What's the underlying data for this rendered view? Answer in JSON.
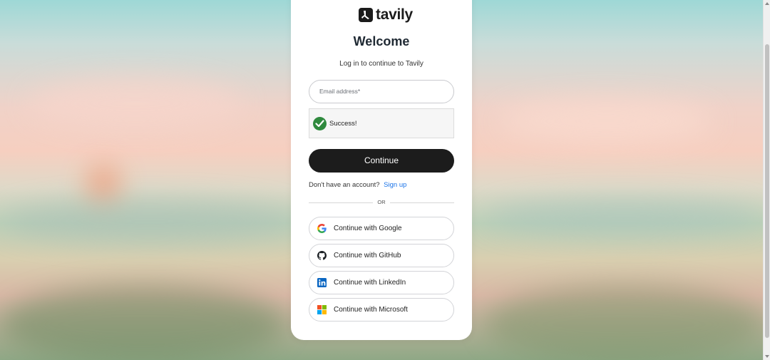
{
  "brand": {
    "name": "tavily",
    "icon": "tavily-logo-icon"
  },
  "heading": {
    "title": "Welcome",
    "subtitle": "Log in to continue to Tavily"
  },
  "email": {
    "placeholder": "Email address*"
  },
  "captcha": {
    "status": "Success!",
    "icon": "checkmark-icon",
    "color": "#2f8a3e"
  },
  "continue": {
    "label": "Continue"
  },
  "signup": {
    "prompt": "Don't have an account?",
    "link": "Sign up"
  },
  "divider": {
    "label": "OR"
  },
  "social": [
    {
      "label": "Continue with Google",
      "icon": "google-icon"
    },
    {
      "label": "Continue with GitHub",
      "icon": "github-icon"
    },
    {
      "label": "Continue with LinkedIn",
      "icon": "linkedin-icon"
    },
    {
      "label": "Continue with Microsoft",
      "icon": "microsoft-icon"
    }
  ],
  "colors": {
    "primary_button": "#1c1c1c",
    "link": "#1a73e8",
    "linkedin": "#0a66c2"
  }
}
